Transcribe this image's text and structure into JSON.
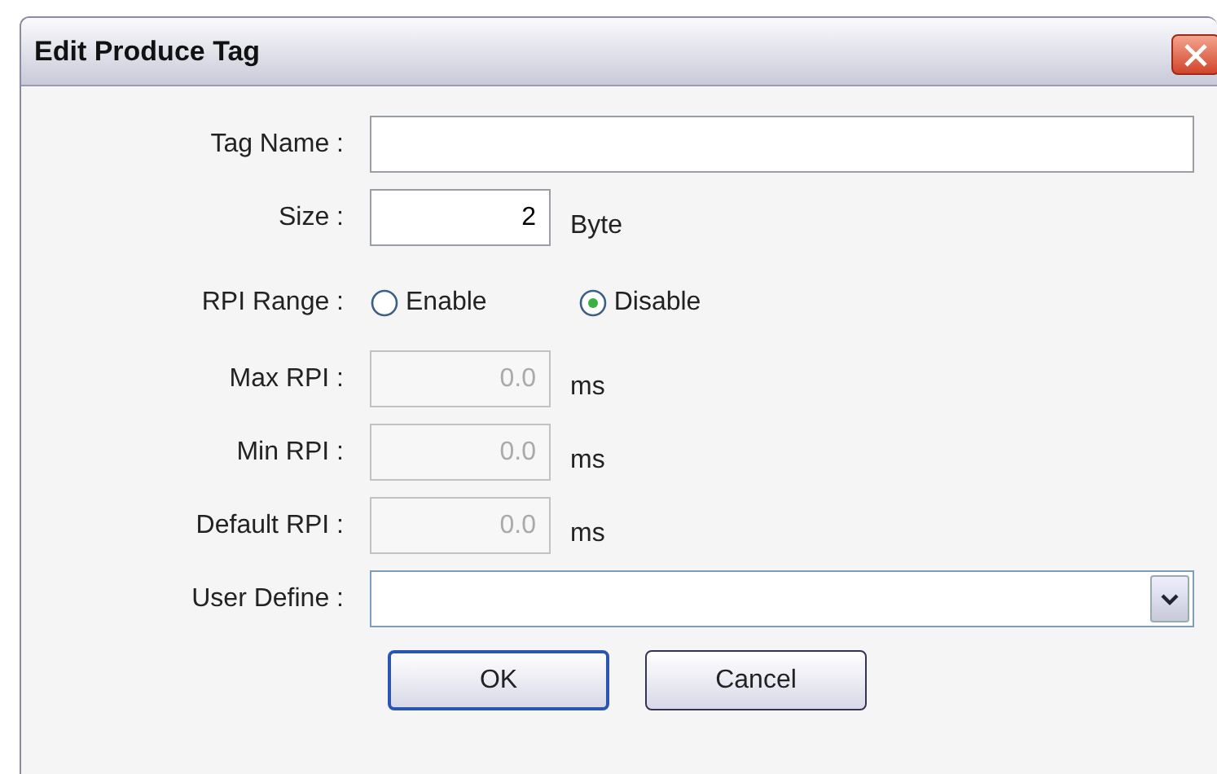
{
  "window": {
    "title": "Edit Produce Tag"
  },
  "fields": [
    {
      "kind": "text",
      "label": "Tag Name :"
    },
    {
      "kind": "unit",
      "label": "Size :",
      "value": "2",
      "unit": "Byte"
    },
    {
      "kind": "radio",
      "label": "RPI Range :",
      "options": [
        {
          "label": "Enable",
          "selected": false
        },
        {
          "label": "Disable",
          "selected": true
        }
      ]
    },
    {
      "kind": "unit",
      "label": "Max RPI :",
      "value": "0.0",
      "unit": "ms",
      "disabled": true
    },
    {
      "kind": "unit",
      "label": "Min RPI :",
      "value": "0.0",
      "unit": "ms",
      "disabled": true
    },
    {
      "kind": "unit",
      "label": "Default RPI :",
      "value": "0.0",
      "unit": "ms",
      "disabled": true
    },
    {
      "kind": "combo",
      "label": "User Define :"
    }
  ],
  "buttons": [
    {
      "label": "OK",
      "default": true
    },
    {
      "label": "Cancel",
      "default": false
    }
  ]
}
